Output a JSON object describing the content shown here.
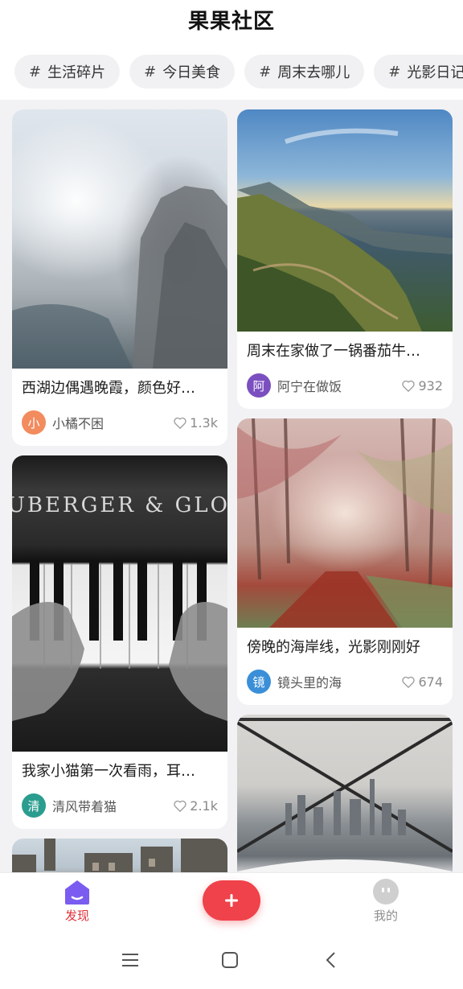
{
  "app": {
    "title": "果果社区"
  },
  "tags": [
    {
      "hash": "#",
      "label": "生活碎片"
    },
    {
      "hash": "#",
      "label": "今日美食"
    },
    {
      "hash": "#",
      "label": "周末去哪儿"
    },
    {
      "hash": "#",
      "label": "光影日记"
    }
  ],
  "posts": [
    {
      "title": "西湖边偶遇晚霞，颜色好…",
      "avatar_text": "小",
      "avatar_color": "#f28b5e",
      "author": "小橘不困",
      "likes": "1.3k",
      "image": "mountain-fog-photo"
    },
    {
      "title": "周末在家做了一锅番茄牛…",
      "avatar_text": "阿",
      "avatar_color": "#7b4fc0",
      "author": "阿宁在做饭",
      "likes": "932",
      "image": "coast-sunset-photo"
    },
    {
      "title": "我家小猫第一次看雨，耳…",
      "avatar_text": "清",
      "avatar_color": "#2a9d8f",
      "author": "清风带着猫",
      "likes": "2.1k",
      "image": "piano-hands-photo"
    },
    {
      "title": "傍晚的海岸线，光影刚刚好",
      "avatar_text": "镜",
      "avatar_color": "#3a8fd8",
      "author": "镜头里的海",
      "likes": "674",
      "image": "autumn-forest-photo"
    },
    {
      "image": "city-skyline-photo"
    },
    {
      "image": "street-buildings-photo"
    }
  ],
  "nav": {
    "discover_label": "发现",
    "add_label": "+",
    "mine_label": "我的"
  },
  "colors": {
    "accent": "#f0424a",
    "active_nav": "#e0313a",
    "home_icon": "#7b5cf0"
  }
}
